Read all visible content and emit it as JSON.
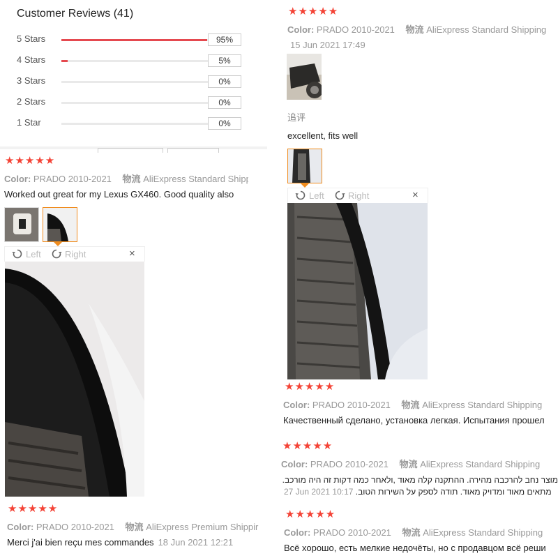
{
  "summary": {
    "title": "Customer Reviews (41)",
    "rows": [
      {
        "label": "5 Stars",
        "pct": "95%",
        "fill": 0.95
      },
      {
        "label": "4 Stars",
        "pct": "5%",
        "fill": 0.04
      },
      {
        "label": "3 Stars",
        "pct": "0%",
        "fill": 0
      },
      {
        "label": "2 Stars",
        "pct": "0%",
        "fill": 0
      },
      {
        "label": "1 Star",
        "pct": "0%",
        "fill": 0
      }
    ]
  },
  "labels": {
    "color_key": "Color:",
    "logistics_key": "物流",
    "rotate_left": "Left",
    "rotate_right": "Right",
    "close": "×",
    "stars": "★★★★★"
  },
  "colors": {
    "star": "#f44336",
    "accent": "#f08c1e",
    "bar": "#e5494f"
  },
  "reviews": {
    "r1": {
      "color": "PRADO 2010-2021",
      "shipping": "AliExpress Standard Shipping",
      "date": "15 Jun 2021 17:49",
      "followup_label": "追评",
      "text": "excellent, fits well"
    },
    "r2": {
      "color": "PRADO 2010-2021",
      "shipping": "AliExpress Standard Shipp",
      "text": "Worked out great for my Lexus GX460. Good quality also"
    },
    "r3": {
      "color": "PRADO 2010-2021",
      "shipping": "AliExpress Premium Shippir",
      "text": "Merci j'ai bien reçu mes commandes",
      "date": "18 Jun 2021 12:21"
    },
    "r4": {
      "color": "PRADO 2010-2021",
      "shipping": "AliExpress Standard Shipping",
      "text": "Качественный сделано, установка легкая. Испытания прошел"
    },
    "r5": {
      "color": "PRADO 2010-2021",
      "shipping": "AliExpress Standard Shipping",
      "text_line1": "מוצר נחב להרכבה מהירה. ההתקנה קלה מאוד ,ולאחר כמה דקות זה היה מורכב. המוצר",
      "text_line2": "מתאים מאוד ומדויק מאוד. תודה לספק על השירות הטוב.",
      "date": "27 Jun 2021 10:17"
    },
    "r6": {
      "color": "PRADO 2010-2021",
      "shipping": "AliExpress Standard Shipping",
      "text": "Всё хорошо, есть мелкие недочёты, но с продавцом всё реши"
    }
  }
}
